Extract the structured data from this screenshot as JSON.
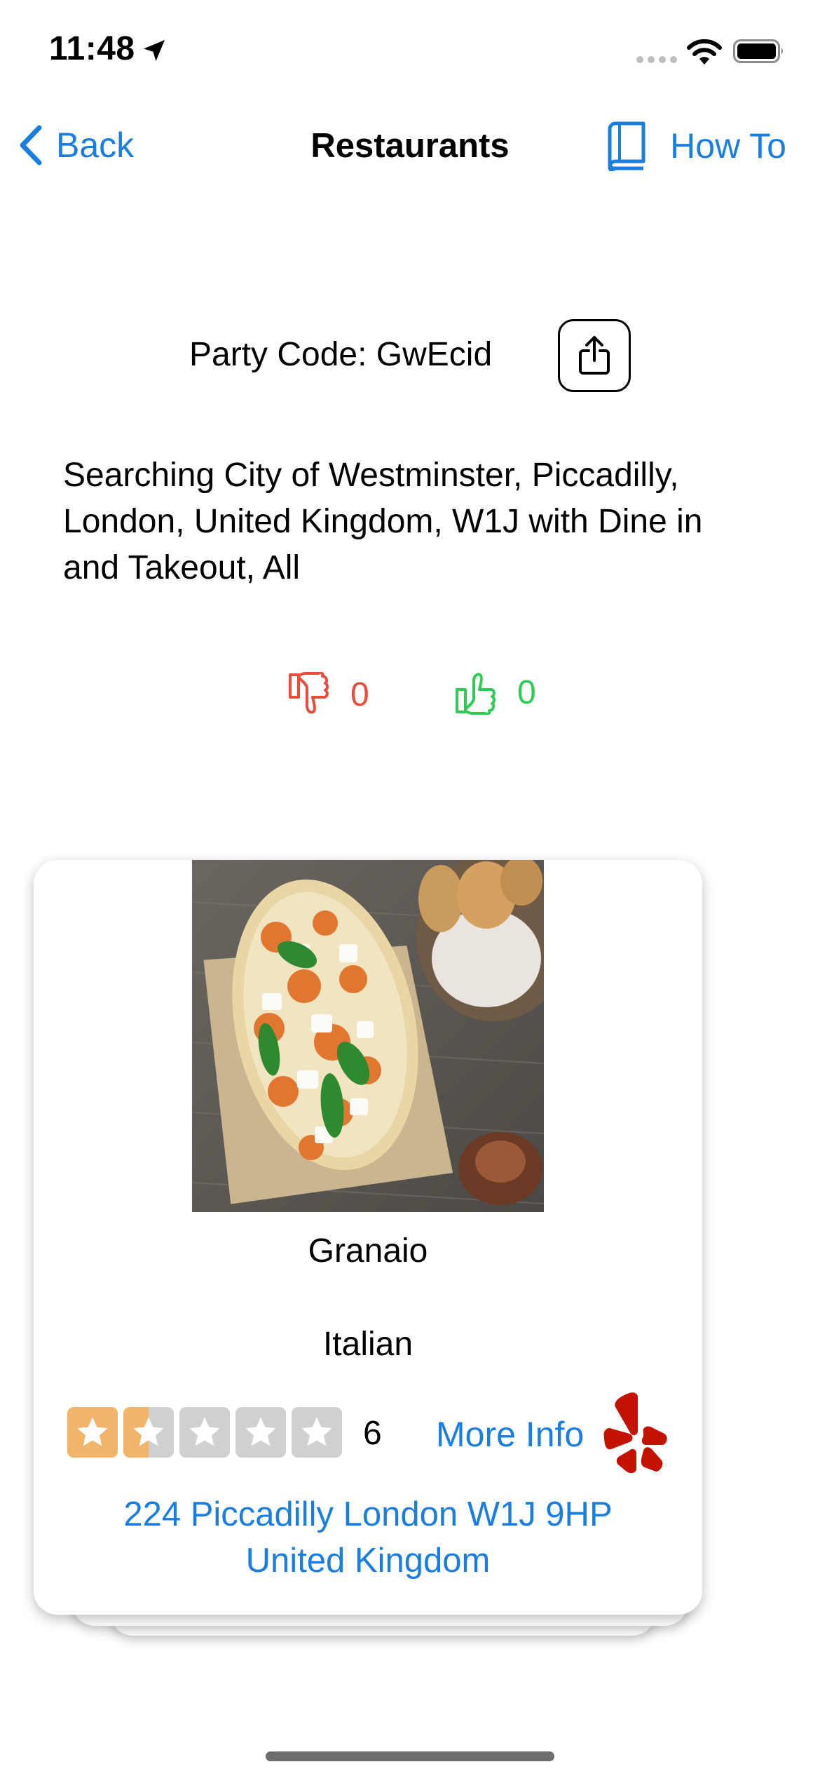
{
  "status_bar": {
    "time": "11:48"
  },
  "nav": {
    "back_label": "Back",
    "title": "Restaurants",
    "how_to_label": "How To"
  },
  "party": {
    "code_text": "Party Code: GwEcid"
  },
  "search": {
    "text": "Searching City of Westminster, Piccadilly, London, United Kingdom, W1J  with Dine in and Takeout, All"
  },
  "votes": {
    "dislikes": "0",
    "likes": "0"
  },
  "restaurant": {
    "name": "Granaio",
    "cuisine": "Italian",
    "rating": 1.5,
    "rating_max": 5,
    "review_count": "6",
    "more_info_label": "More Info",
    "address_line1": "224 Piccadilly London W1J 9HP",
    "address_line2": "United Kingdom"
  },
  "colors": {
    "accent": "#1a7ee0",
    "dislike": "#e74c3c",
    "like": "#2ecc55",
    "star_filled": "#f0b56a",
    "star_empty": "#d0d0d0",
    "yelp": "#c41200"
  }
}
